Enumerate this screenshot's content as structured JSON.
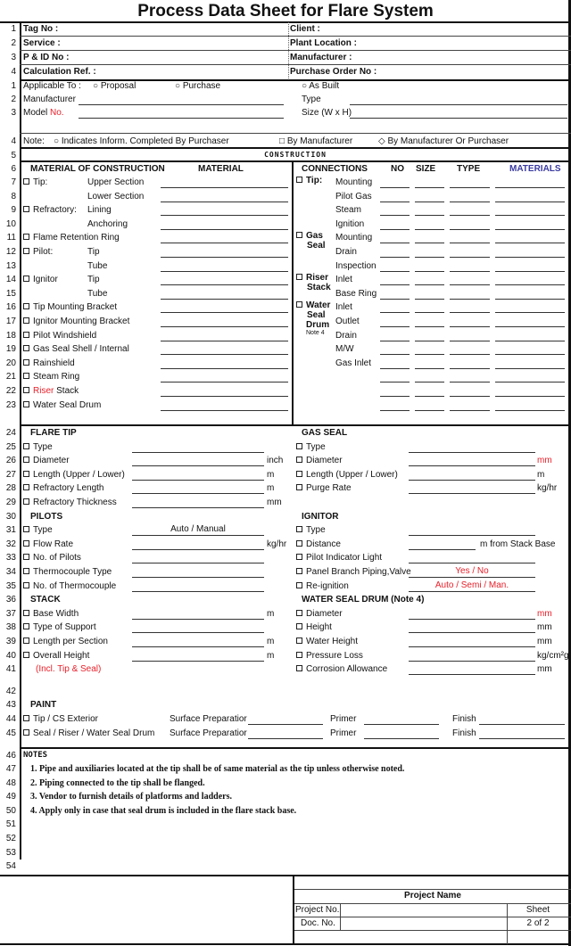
{
  "title": "Process Data Sheet for Flare System",
  "header_rows": [
    {
      "num": "1",
      "left": "Tag No  :",
      "right": "Client :"
    },
    {
      "num": "2",
      "left": "Service :",
      "right": "Plant Location :"
    },
    {
      "num": "3",
      "left": "P & ID  No :",
      "right": "Manufacturer :"
    },
    {
      "num": "4",
      "left": "Calculation Ref. :",
      "right": "Purchase Order No :"
    }
  ],
  "applicable": {
    "num1": "1",
    "label": "Applicable To :",
    "opt1": "○ Proposal",
    "opt2": "○ Purchase",
    "opt3": "○ As Built",
    "num2": "2",
    "manufacturer": "Manufacturer",
    "type": "Type",
    "num3": "3",
    "model": "Model ",
    "model_red": "No.",
    "size": "Size (W x H)",
    "num4": "4",
    "note": "Note:",
    "note1": "○ Indicates Inform. Completed By Purchaser",
    "note2": "□ By Manufacturer",
    "note3": "◇ By Manufacturer Or Purchaser"
  },
  "construction": {
    "num": "5",
    "heading": "CONSTRUCTION",
    "moc_num": "6",
    "moc_heading": "MATERIAL OF CONSTRUCTION",
    "material_heading": "MATERIAL",
    "moc_rows": [
      {
        "num": "7",
        "check": true,
        "label": "Tip:",
        "sub": "Upper Section"
      },
      {
        "num": "8",
        "check": false,
        "label": "",
        "sub": "Lower Section"
      },
      {
        "num": "9",
        "check": true,
        "label": "Refractory:",
        "sub": "Lining"
      },
      {
        "num": "10",
        "check": false,
        "label": "",
        "sub": "Anchoring"
      },
      {
        "num": "11",
        "check": true,
        "label": "Flame Retention Ring",
        "sub": ""
      },
      {
        "num": "12",
        "check": true,
        "label": "Pilot:",
        "sub": "Tip"
      },
      {
        "num": "13",
        "check": false,
        "label": "",
        "sub": "Tube"
      },
      {
        "num": "14",
        "check": true,
        "label": "Ignitor",
        "sub": "Tip"
      },
      {
        "num": "15",
        "check": false,
        "label": "",
        "sub": "Tube"
      },
      {
        "num": "16",
        "check": true,
        "label": "Tip Mounting Bracket",
        "sub": ""
      },
      {
        "num": "17",
        "check": true,
        "label": "Ignitor Mounting Bracket",
        "sub": ""
      },
      {
        "num": "18",
        "check": true,
        "label": "Pilot Windshield",
        "sub": ""
      },
      {
        "num": "19",
        "check": true,
        "label": "Gas Seal Shell / Internal",
        "sub": ""
      },
      {
        "num": "20",
        "check": true,
        "label": "Rainshield",
        "sub": ""
      },
      {
        "num": "21",
        "check": true,
        "label": "Steam Ring",
        "sub": ""
      },
      {
        "num": "22",
        "check": true,
        "label": "Stack",
        "label_red": "Riser ",
        "sub": ""
      },
      {
        "num": "23",
        "check": true,
        "label": "Water Seal Drum",
        "sub": ""
      }
    ],
    "conn_headers": {
      "connections": "CONNECTIONS",
      "no": "NO",
      "size": "SIZE",
      "type": "TYPE",
      "materials": "MATERIALS"
    },
    "conn_groups": [
      {
        "label": "Tip:",
        "items": [
          "Mounting",
          "Pilot Gas",
          "Steam",
          "Ignition"
        ]
      },
      {
        "label": "Gas",
        "label2": "Seal",
        "items": [
          "Mounting",
          "Drain",
          "Inspection"
        ]
      },
      {
        "label": "Riser",
        "label2": "Stack",
        "items": [
          "Inlet",
          "Base Ring"
        ]
      },
      {
        "label": "Water",
        "label2": "Seal",
        "label3": "Drum",
        "label4": "Note 4",
        "items": [
          "Inlet",
          "Outlet",
          "Drain",
          "M/W",
          "Gas Inlet"
        ]
      }
    ]
  },
  "flare_tip": {
    "num": "24",
    "heading": "FLARE TIP",
    "rows": [
      {
        "num": "25",
        "label": "Type",
        "unit": ""
      },
      {
        "num": "26",
        "label": "Diameter",
        "unit": "inch"
      },
      {
        "num": "27",
        "label": "Length (Upper / Lower)",
        "unit": "m"
      },
      {
        "num": "28",
        "label": "Refractory Length",
        "unit": "m"
      },
      {
        "num": "29",
        "label": "Refractory Thickness",
        "unit": "mm"
      }
    ]
  },
  "pilots": {
    "num": "30",
    "heading": "PILOTS",
    "rows": [
      {
        "num": "31",
        "label": "Type",
        "value": "Auto / Manual",
        "unit": ""
      },
      {
        "num": "32",
        "label": "Flow Rate",
        "unit": "kg/hr"
      },
      {
        "num": "33",
        "label": "No. of Pilots",
        "unit": ""
      },
      {
        "num": "34",
        "label": "Thermocouple Type",
        "unit": ""
      },
      {
        "num": "35",
        "label": "No. of Thermocouple",
        "unit": ""
      }
    ]
  },
  "stack": {
    "num": "36",
    "heading": "STACK",
    "rows": [
      {
        "num": "37",
        "label": "Base Width",
        "unit": "m"
      },
      {
        "num": "38",
        "label": "Type of Support",
        "unit": ""
      },
      {
        "num": "39",
        "label": "Length per Section",
        "unit": "m"
      },
      {
        "num": "40",
        "label": "Overall Height",
        "unit": "m"
      }
    ],
    "note_num": "41",
    "note": "(Incl. Tip & Seal)"
  },
  "gas_seal": {
    "heading": "GAS SEAL",
    "rows": [
      {
        "label": "Type",
        "unit": ""
      },
      {
        "label": "Diameter",
        "unit": "mm",
        "unit_red": true
      },
      {
        "label": "Length (Upper / Lower)",
        "unit": "m"
      },
      {
        "label": "Purge Rate",
        "unit": "kg/hr"
      }
    ]
  },
  "ignitor": {
    "heading": "IGNITOR",
    "rows": [
      {
        "label": "Type",
        "unit": ""
      },
      {
        "label": "Distance",
        "unit": "m from Stack Base"
      },
      {
        "label": "Pilot Indicator Light",
        "unit": ""
      },
      {
        "label": "Panel Branch Piping,Valve",
        "value": "Yes / No"
      },
      {
        "label": "Re-ignition",
        "value": "Auto / Semi / Man."
      }
    ]
  },
  "water_seal_drum": {
    "heading": "WATER SEAL DRUM (Note 4)",
    "rows": [
      {
        "label": "Diameter",
        "unit": "mm",
        "unit_red": true
      },
      {
        "label": "Height",
        "unit": "mm"
      },
      {
        "label": "Water Height",
        "unit": "mm"
      },
      {
        "label": "Pressure Loss",
        "unit": "kg/cm²g"
      },
      {
        "label": "Corrosion Allowance",
        "unit": "mm"
      }
    ]
  },
  "paint": {
    "num42": "42",
    "num": "43",
    "heading": "PAINT",
    "rows": [
      {
        "num": "44",
        "label": "Tip / CS Exterior",
        "surface": "Surface Preparatior",
        "primer": "Primer",
        "finish": "Finish"
      },
      {
        "num": "45",
        "label": "Seal / Riser / Water Seal Drum",
        "surface": "Surface Preparatior",
        "primer": "Primer",
        "finish": "Finish"
      }
    ]
  },
  "notes": {
    "num": "46",
    "heading": "NOTES",
    "items": [
      {
        "num": "47",
        "text": "1. Pipe and auxiliaries located at the tip shall be of same material as the tip unless otherwise noted."
      },
      {
        "num": "48",
        "text": "2. Piping connected to the tip shall be flanged."
      },
      {
        "num": "49",
        "text": "3. Vendor to furnish details of platforms and ladders."
      },
      {
        "num": "50",
        "text": "4. Apply only in case that seal drum is included in the flare stack base."
      },
      {
        "num": "51",
        "text": ""
      },
      {
        "num": "52",
        "text": ""
      },
      {
        "num": "53",
        "text": ""
      },
      {
        "num": "54",
        "text": ""
      }
    ]
  },
  "title_block": {
    "project_name": "Project Name",
    "project_no": "Project No.",
    "doc_no": "Doc. No.",
    "sheet": "Sheet",
    "sheet_value": "2 of 2"
  }
}
